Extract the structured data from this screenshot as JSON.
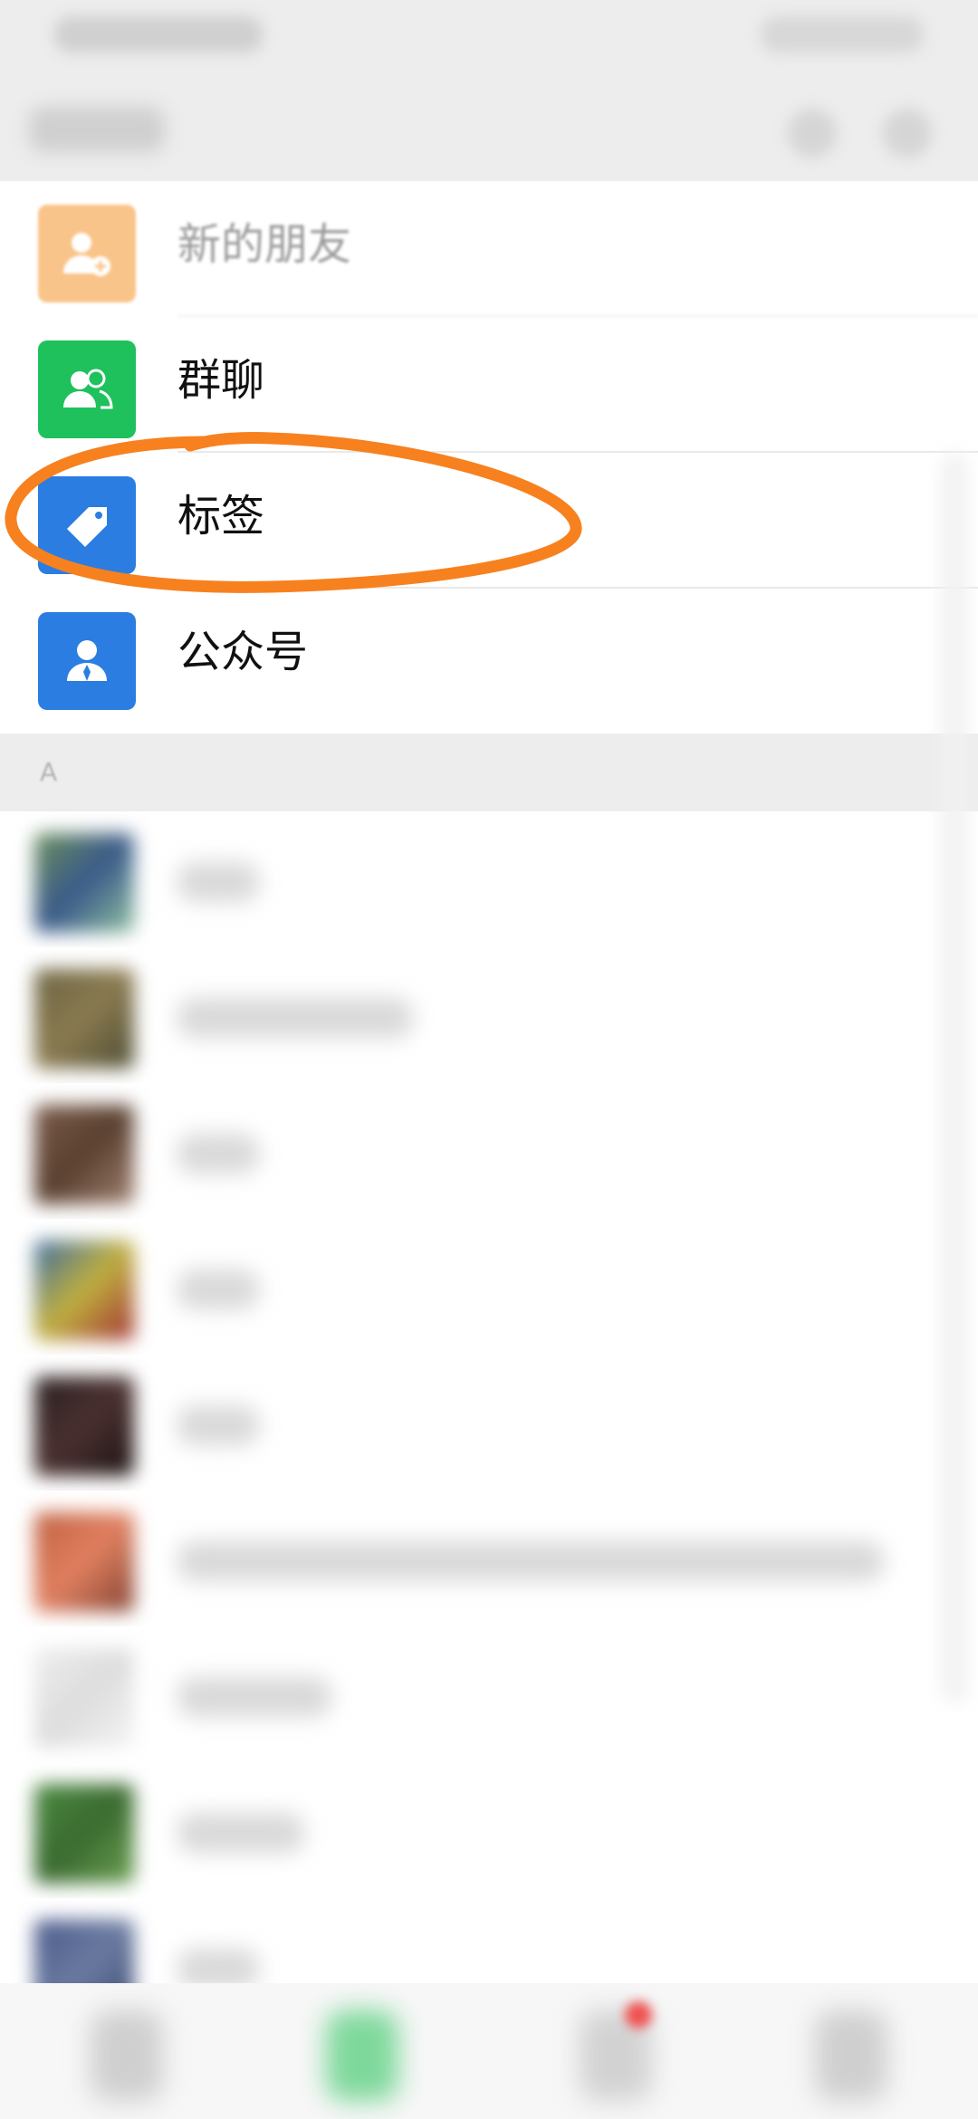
{
  "list": {
    "items": [
      {
        "label": "新的朋友",
        "icon": "person-add-icon",
        "color": "#f7a54b"
      },
      {
        "label": "群聊",
        "icon": "group-icon",
        "color": "#1ec15c"
      },
      {
        "label": "标签",
        "icon": "tag-icon",
        "color": "#2b7de1"
      },
      {
        "label": "公众号",
        "icon": "official-account-icon",
        "color": "#2b7de1"
      }
    ]
  },
  "sections": {
    "a": {
      "letter": "A"
    }
  },
  "annotation": {
    "color": "#f7811f"
  }
}
